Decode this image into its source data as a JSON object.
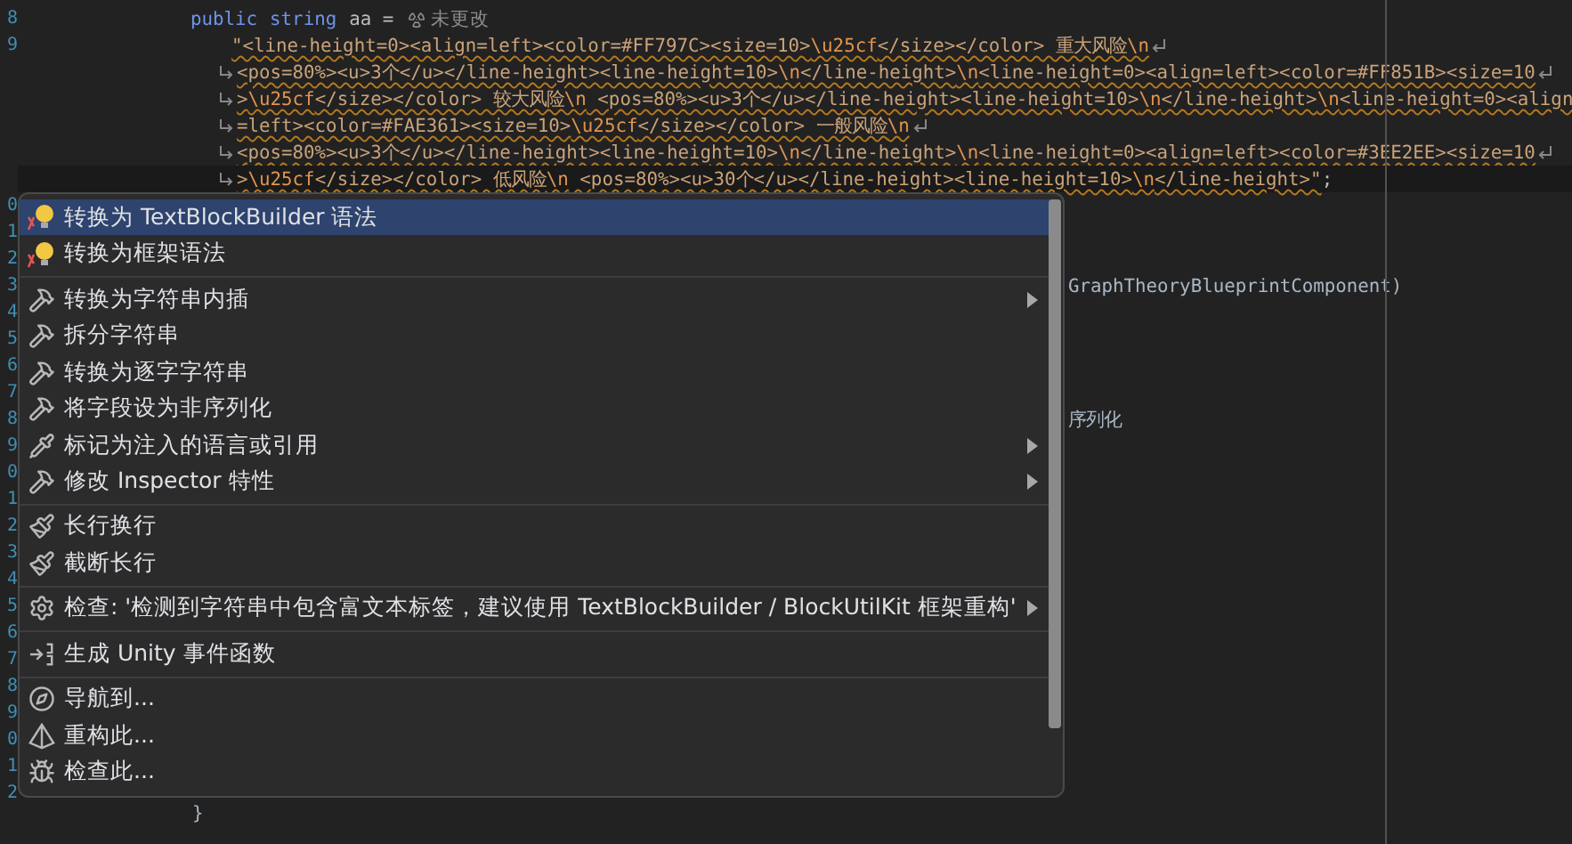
{
  "editor": {
    "gutter": {
      "line_numbers": [
        "8",
        "9",
        "0",
        "1",
        "2",
        "3",
        "4",
        "5",
        "6",
        "7",
        "8",
        "9",
        "0",
        "1",
        "2",
        "3",
        "4",
        "5",
        "6",
        "7",
        "8",
        "9",
        "0",
        "1",
        "2"
      ]
    },
    "declaration": {
      "keyword_1": "public",
      "keyword_2": "string",
      "name": "aa =",
      "hint": "未更改"
    },
    "string_lines": [
      {
        "wrap_start": false,
        "wrap_end": true,
        "current": false,
        "segments": [
          {
            "kind": "str",
            "text": "\"<line-height=0><align=left><color=#FF797C><size=10>"
          },
          {
            "kind": "esc",
            "text": "\\u25cf"
          },
          {
            "kind": "str",
            "text": "</size></color> 重大风险"
          },
          {
            "kind": "esc",
            "text": "\\n"
          }
        ]
      },
      {
        "wrap_start": true,
        "wrap_end": true,
        "current": false,
        "segments": [
          {
            "kind": "str",
            "text": "<pos=80%><u>3个</u></line-height><line-height=10>"
          },
          {
            "kind": "esc",
            "text": "\\n"
          },
          {
            "kind": "str",
            "text": "</line-height>"
          },
          {
            "kind": "esc",
            "text": "\\n"
          },
          {
            "kind": "str",
            "text": "<line-height=0><align=left><color=#FF851B><size=10"
          }
        ]
      },
      {
        "wrap_start": true,
        "wrap_end": true,
        "current": false,
        "segments": [
          {
            "kind": "str",
            "text": ">"
          },
          {
            "kind": "esc",
            "text": "\\u25cf"
          },
          {
            "kind": "str",
            "text": "</size></color> 较大风险"
          },
          {
            "kind": "esc",
            "text": "\\n"
          },
          {
            "kind": "str",
            "text": " <pos=80%><u>3个</u></line-height><line-height=10>"
          },
          {
            "kind": "esc",
            "text": "\\n"
          },
          {
            "kind": "str",
            "text": "</line-height>"
          },
          {
            "kind": "esc",
            "text": "\\n"
          },
          {
            "kind": "str",
            "text": "<line-height=0><align"
          }
        ]
      },
      {
        "wrap_start": true,
        "wrap_end": true,
        "current": false,
        "segments": [
          {
            "kind": "str",
            "text": "=left><color=#FAE361><size=10>"
          },
          {
            "kind": "esc",
            "text": "\\u25cf"
          },
          {
            "kind": "str",
            "text": "</size></color> 一般风险"
          },
          {
            "kind": "esc",
            "text": "\\n"
          }
        ]
      },
      {
        "wrap_start": true,
        "wrap_end": true,
        "current": false,
        "segments": [
          {
            "kind": "str",
            "text": "<pos=80%><u>3个</u></line-height><line-height=10>"
          },
          {
            "kind": "esc",
            "text": "\\n"
          },
          {
            "kind": "str",
            "text": "</line-height>"
          },
          {
            "kind": "esc",
            "text": "\\n"
          },
          {
            "kind": "str",
            "text": "<line-height=0><align=left><color=#3EE2EE><size=10"
          }
        ]
      },
      {
        "wrap_start": true,
        "wrap_end": false,
        "current": true,
        "segments": [
          {
            "kind": "str",
            "text": ">"
          },
          {
            "kind": "esc",
            "text": "\\u25cf"
          },
          {
            "kind": "str",
            "text": "</size></color> 低风险"
          },
          {
            "kind": "esc",
            "text": "\\n"
          },
          {
            "kind": "str",
            "text": " <pos=80%><u>30个</u></line-height><line-height=10>"
          },
          {
            "kind": "esc",
            "text": "\\n"
          },
          {
            "kind": "str",
            "text": "</line-height>\""
          },
          {
            "kind": "punct",
            "text": ";"
          }
        ]
      }
    ],
    "covered_lines": [
      {
        "kind": "tail",
        "text": "GraphTheoryBlueprintComponent)"
      },
      {
        "kind": "tail",
        "text": "序列化"
      },
      {
        "kind": "brace",
        "text": "}"
      }
    ]
  },
  "context_menu": {
    "groups": [
      {
        "items": [
          {
            "kind": "bulb",
            "label": "转换为 TextBlockBuilder 语法",
            "submenu": false,
            "selected": true
          },
          {
            "kind": "bulb",
            "label": "转换为框架语法",
            "submenu": false,
            "selected": false
          }
        ]
      },
      {
        "items": [
          {
            "kind": "hammer",
            "label": "转换为字符串内插",
            "submenu": true,
            "selected": false
          },
          {
            "kind": "hammer",
            "label": "拆分字符串",
            "submenu": false,
            "selected": false
          },
          {
            "kind": "hammer",
            "label": "转换为逐字字符串",
            "submenu": false,
            "selected": false
          },
          {
            "kind": "hammer",
            "label": "将字段设为非序列化",
            "submenu": false,
            "selected": false
          },
          {
            "kind": "pipette",
            "label": "标记为注入的语言或引用",
            "submenu": true,
            "selected": false
          },
          {
            "kind": "hammer",
            "label": "修改 Inspector 特性",
            "submenu": true,
            "selected": false
          }
        ]
      },
      {
        "items": [
          {
            "kind": "brush",
            "label": "长行换行",
            "submenu": false,
            "selected": false
          },
          {
            "kind": "brush",
            "label": "截断长行",
            "submenu": false,
            "selected": false
          }
        ]
      },
      {
        "items": [
          {
            "kind": "gear",
            "label": "检查: '检测到字符串中包含富文本标签，建议使用 TextBlockBuilder / BlockUtilKit 框架重构'",
            "submenu": true,
            "selected": false
          }
        ]
      },
      {
        "items": [
          {
            "kind": "generate",
            "label": "生成 Unity 事件函数",
            "submenu": false,
            "selected": false
          }
        ]
      },
      {
        "items": [
          {
            "kind": "compass",
            "label": "导航到...",
            "submenu": false,
            "selected": false
          },
          {
            "kind": "pyramid",
            "label": "重构此...",
            "submenu": false,
            "selected": false
          },
          {
            "kind": "inspect",
            "label": "检查此...",
            "submenu": false,
            "selected": false
          }
        ]
      }
    ]
  }
}
